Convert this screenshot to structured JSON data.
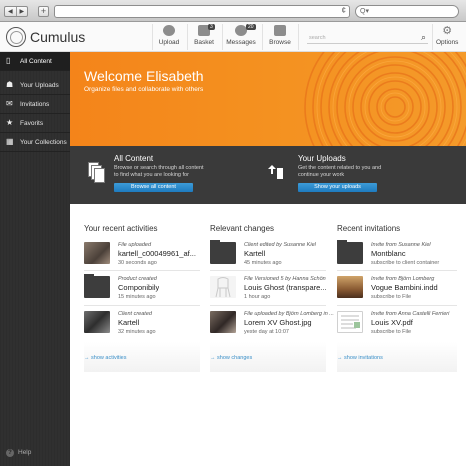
{
  "browser": {
    "back_glyph": "◀",
    "forward_glyph": "▶",
    "new_tab_glyph": "+",
    "reload_glyph": "¢",
    "search_glyph": "Q▾"
  },
  "header": {
    "brand": "Cumulus",
    "nav": [
      {
        "label": "Upload",
        "icon": "upload-icon",
        "badge": ""
      },
      {
        "label": "Basket",
        "icon": "basket-icon",
        "badge": "3"
      },
      {
        "label": "Messages",
        "icon": "messages-icon",
        "badge": "20"
      },
      {
        "label": "Browse",
        "icon": "folder-icon",
        "badge": ""
      }
    ],
    "search_placeholder": "search",
    "options_label": "Options"
  },
  "sidebar": {
    "items": [
      {
        "label": "All Content",
        "icon": "file-icon",
        "active": true
      },
      {
        "label": "Your Uploads",
        "icon": "user-upload-icon",
        "active": false
      },
      {
        "label": "Invitations",
        "icon": "envelope-icon",
        "active": false
      },
      {
        "label": "Favorits",
        "icon": "star-icon",
        "active": false
      },
      {
        "label": "Your Collections",
        "icon": "grid-icon",
        "active": false
      }
    ],
    "help_label": "Help"
  },
  "banner": {
    "title": "Welcome Elisabeth",
    "subtitle": "Organize files and collaborate with others"
  },
  "features": {
    "all_content": {
      "title": "All Content",
      "desc_line1": "Browse or search through all content",
      "desc_line2": "to find what you are looking for",
      "button": "Browse all content"
    },
    "uploads": {
      "title": "Your Uploads",
      "desc_line1": "Get the content related to you and",
      "desc_line2": "continue your work",
      "button": "Show your uploads"
    }
  },
  "activities": {
    "title": "Your recent activities",
    "items": [
      {
        "meta": "File uploaded",
        "name": "kartell_c00049961_af...",
        "time": "30 seconds ago"
      },
      {
        "meta": "Product created",
        "name": "Componibily",
        "time": "15 minutes ago"
      },
      {
        "meta": "Client created",
        "name": "Kartell",
        "time": "32 minutes ago"
      }
    ],
    "show_link": "→ show activities"
  },
  "changes": {
    "title": "Relevant changes",
    "items": [
      {
        "meta": "Client edited by Susanne Kiel",
        "name": "Kartell",
        "time": "45 minutes ago"
      },
      {
        "meta": "File Versioned 5 by Hanna Schön",
        "name": "Louis Ghost (transpare...",
        "time": "1 hour ago"
      },
      {
        "meta": "File uploaded by Björn Lomberg in ...",
        "name": "Lorem XV Ghost.jpg",
        "time": "yeste day at 10:07"
      }
    ],
    "show_link": "→ show changes"
  },
  "invitations": {
    "title": "Recent invitations",
    "items": [
      {
        "meta": "Invite from Susanne Kiel",
        "name": "Montblanc",
        "time": "subscribe to client container"
      },
      {
        "meta": "Invite from Björn Lomberg",
        "name": "Vogue Bambini.indd",
        "time": "subscribe to File"
      },
      {
        "meta": "Invite from Anna Castelli Ferrieri",
        "name": "Louis XV.pdf",
        "time": "subscribe to File"
      }
    ],
    "show_link": "→ show invitations"
  }
}
